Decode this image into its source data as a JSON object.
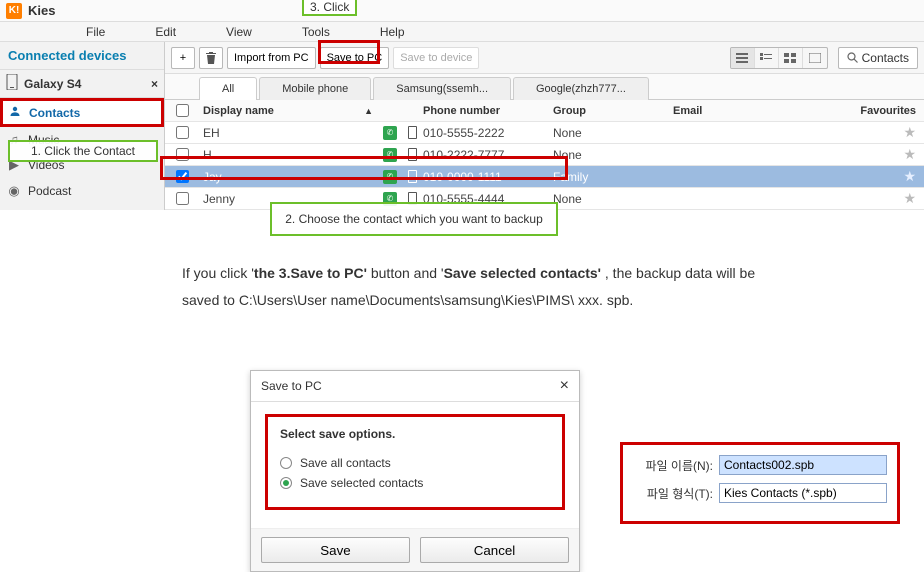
{
  "app": {
    "title": "Kies",
    "logo_text": "K!"
  },
  "menu": {
    "file": "File",
    "edit": "Edit",
    "view": "View",
    "tools": "Tools",
    "help": "Help"
  },
  "sidebar": {
    "header": "Connected devices",
    "device": {
      "name": "Galaxy S4",
      "close": "×"
    },
    "items": [
      {
        "label": "Contacts"
      },
      {
        "label": "Music"
      },
      {
        "label": "Videos"
      },
      {
        "label": "Podcast"
      }
    ]
  },
  "toolbar": {
    "add": "+",
    "delete_title": "Delete",
    "import": "Import from PC",
    "save_pc": "Save to PC",
    "save_device": "Save to device",
    "search_label": "Contacts"
  },
  "source_tabs": [
    {
      "label": "All",
      "active": true
    },
    {
      "label": "Mobile phone"
    },
    {
      "label": "Samsung(ssemh..."
    },
    {
      "label": "Google(zhzh777..."
    }
  ],
  "columns": {
    "name": "Display name",
    "phone": "Phone number",
    "group": "Group",
    "email": "Email",
    "fav": "Favourites"
  },
  "rows": [
    {
      "checked": false,
      "name": "EH",
      "phone": "010-5555-2222",
      "group": "None",
      "selected": false
    },
    {
      "checked": false,
      "name": "H",
      "phone": "010-2222-7777",
      "group": "None",
      "selected": false
    },
    {
      "checked": true,
      "name": "Jay",
      "phone": "010-0000-1111",
      "group": "Family",
      "selected": true
    },
    {
      "checked": false,
      "name": "Jenny",
      "phone": "010-5555-4444",
      "group": "None",
      "selected": false
    }
  ],
  "annotations": {
    "step1": "1. Click the Contact",
    "step2": "2. Choose the contact which you want to backup",
    "step3": "3. Click"
  },
  "explain": {
    "line1a": "If you click '",
    "line1b": "the 3.Save to PC'",
    "line1c": " button and '",
    "line1d": "Save selected contacts'",
    "line1e": " , the backup data will be",
    "line2": "saved to C:\\Users\\User name\\Documents\\samsung\\Kies\\PIMS\\ xxx. spb."
  },
  "dialog": {
    "title": "Save to PC",
    "heading": "Select save options.",
    "opt_all": "Save all contacts",
    "opt_selected": "Save selected contacts",
    "save": "Save",
    "cancel": "Cancel"
  },
  "filebox": {
    "name_label": "파일 이름(N):",
    "name_value": "Contacts002.spb",
    "type_label": "파일 형식(T):",
    "type_value": "Kies Contacts (*.spb)"
  }
}
